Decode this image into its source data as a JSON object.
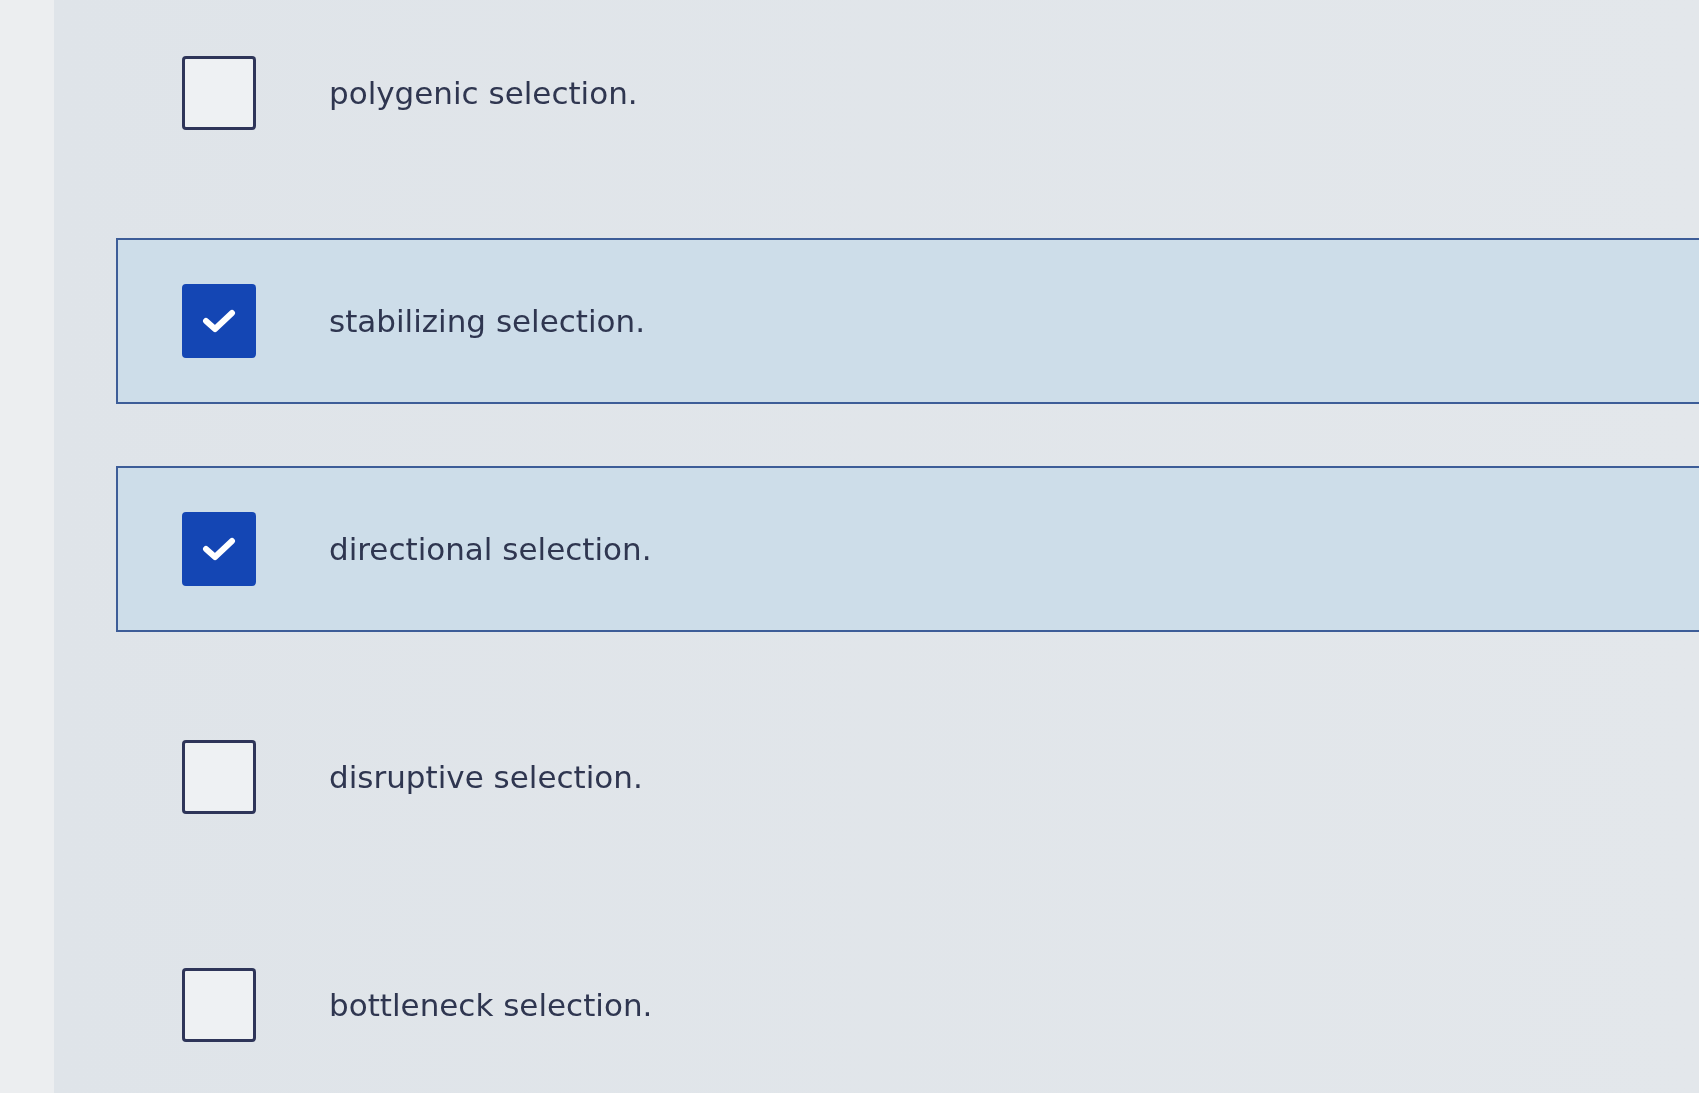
{
  "options": [
    {
      "label": "polygenic selection.",
      "checked": false
    },
    {
      "label": "stabilizing selection.",
      "checked": true
    },
    {
      "label": "directional selection.",
      "checked": true
    },
    {
      "label": "disruptive selection.",
      "checked": false
    },
    {
      "label": "bottleneck selection.",
      "checked": false
    }
  ]
}
